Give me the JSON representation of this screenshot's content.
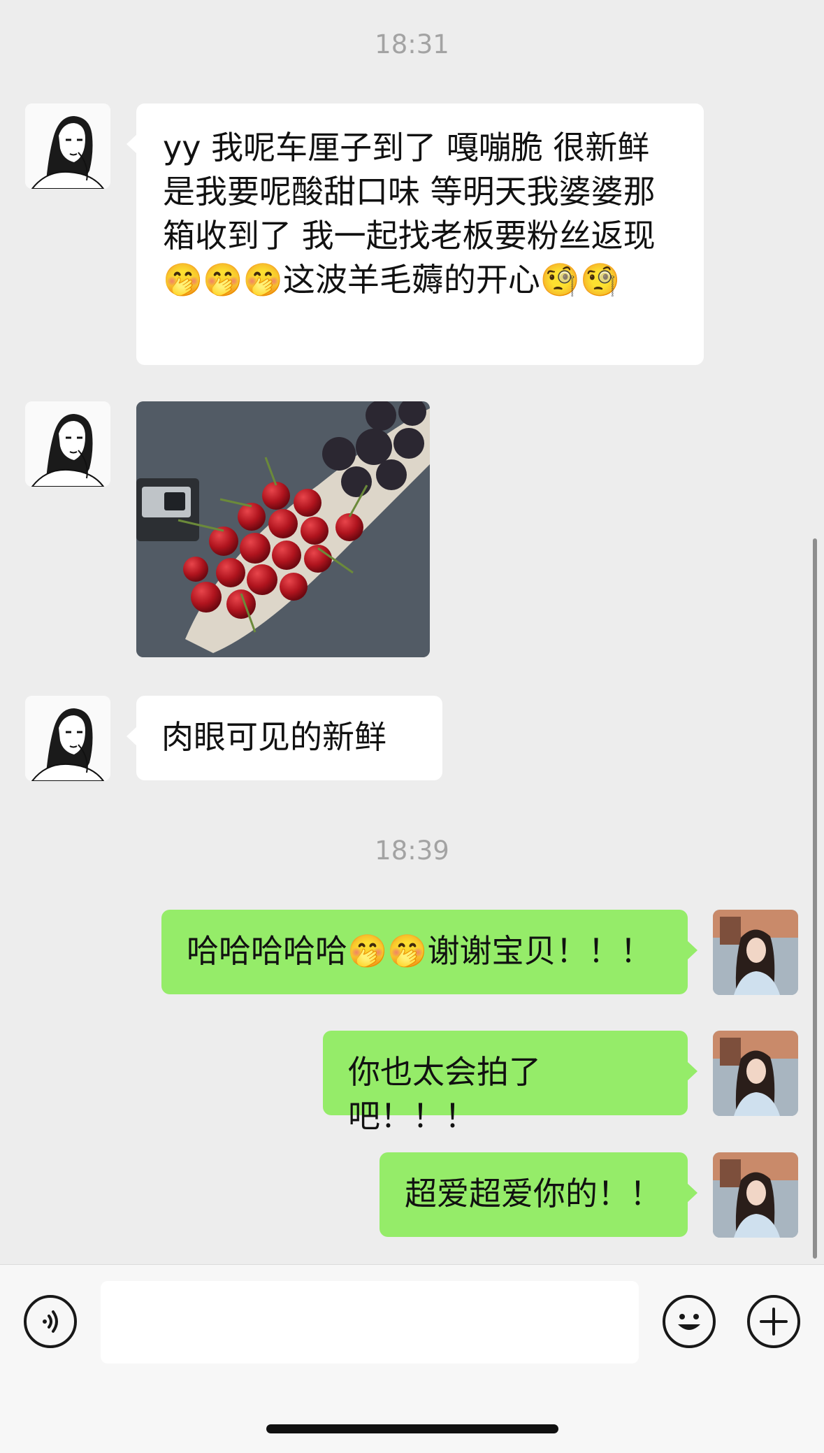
{
  "chat": {
    "timestamp_1": "18:31",
    "timestamp_2": "18:39",
    "messages": [
      {
        "direction": "incoming",
        "type": "text",
        "text": "yy 我呢车厘子到了 嘎嘣脆 很新鲜 是我要呢酸甜口味  等明天我婆婆那箱收到了 我一起找老板要粉丝返现🤭🤭🤭这波羊毛薅的开心🧐🧐"
      },
      {
        "direction": "incoming",
        "type": "image",
        "description": "cherries-and-bayberries-photo"
      },
      {
        "direction": "incoming",
        "type": "text",
        "text": "肉眼可见的新鲜"
      },
      {
        "direction": "outgoing",
        "type": "text",
        "text": "哈哈哈哈哈🤭🤭谢谢宝贝！！！"
      },
      {
        "direction": "outgoing",
        "type": "text",
        "text": "你也太会拍了吧！！！"
      },
      {
        "direction": "outgoing",
        "type": "text",
        "text": "超爱超爱你的！！"
      }
    ]
  },
  "input_bar": {
    "voice_icon": "voice-icon",
    "emoji_icon": "emoji-icon",
    "more_icon": "plus-icon",
    "input_value": ""
  },
  "colors": {
    "background": "#ededed",
    "incoming_bubble": "#ffffff",
    "outgoing_bubble": "#95ec69",
    "timestamp": "#a3a3a3"
  }
}
